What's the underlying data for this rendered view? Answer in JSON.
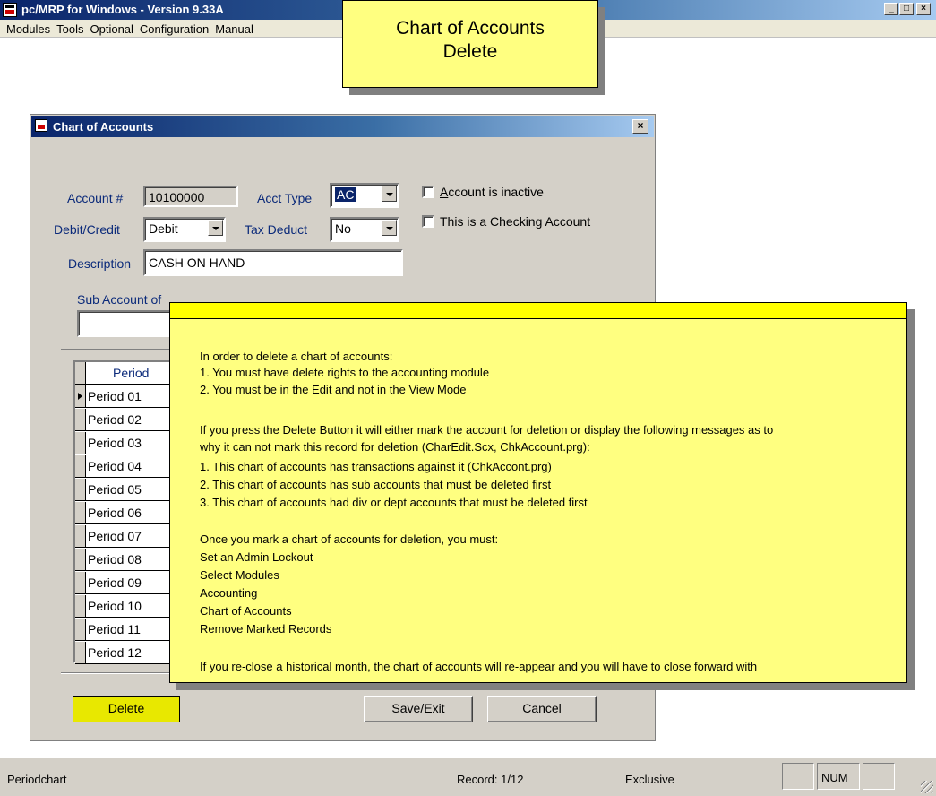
{
  "window": {
    "title": "pc/MRP for Windows - Version 9.33A",
    "controls": {
      "minimize": "_",
      "maximize": "□",
      "close": "×"
    }
  },
  "menu": [
    "Modules",
    "Tools",
    "Optional",
    "Configuration",
    "Manual"
  ],
  "callout": {
    "line1": "Chart of Accounts",
    "line2": "Delete"
  },
  "dialog": {
    "title": "Chart of Accounts",
    "close": "×",
    "account_label": "Account #",
    "account_value": "10100000",
    "acct_type_label": "Acct Type",
    "acct_type_value": "AC",
    "debit_credit_label": "Debit/Credit",
    "debit_credit_value": "Debit",
    "tax_deduct_label": "Tax Deduct",
    "tax_deduct_value": "No",
    "description_label": "Description",
    "description_value": "CASH ON HAND",
    "inactive_label_u": "A",
    "inactive_label_rest": "ccount is inactive",
    "checking_label": "This is a Checking Account",
    "sub_account_label": "Sub Account of",
    "grid_header": "Period",
    "periods": [
      "Period 01",
      "Period 02",
      "Period 03",
      "Period 04",
      "Period 05",
      "Period 06",
      "Period 07",
      "Period 08",
      "Period 09",
      "Period 10",
      "Period 11",
      "Period 12"
    ],
    "buttons": {
      "delete_u": "D",
      "delete_rest": "elete",
      "save_u": "S",
      "save_rest": "ave/Exit",
      "cancel_u": "C",
      "cancel_rest": "ancel"
    }
  },
  "help": {
    "lines": [
      "In order to delete a chart of accounts:",
      "1.  You must have delete rights to the accounting module",
      "2.  You must be in the Edit and not in the View Mode",
      "If you press the Delete Button it will either mark the account for deletion or display the following messages as to",
      "why it can not mark this record for deletion (CharEdit.Scx, ChkAccount.prg):",
      "1.  This chart of accounts has transactions against it (ChkAccont.prg)",
      "2.  This chart of accounts has sub accounts that must be deleted first",
      "3.  This chart of accounts had div or dept accounts that must be deleted first",
      "Once you mark a chart of accounts for deletion, you must:",
      "Set an Admin Lockout",
      "Select Modules",
      "Accounting",
      "Chart of Accounts",
      "Remove Marked Records",
      "If you re-close a historical month, the chart of accounts will re-appear and you will have to close forward with"
    ]
  },
  "status": {
    "left": "Periodchart",
    "record": "Record: 1/12",
    "mode": "Exclusive",
    "num": "NUM"
  }
}
